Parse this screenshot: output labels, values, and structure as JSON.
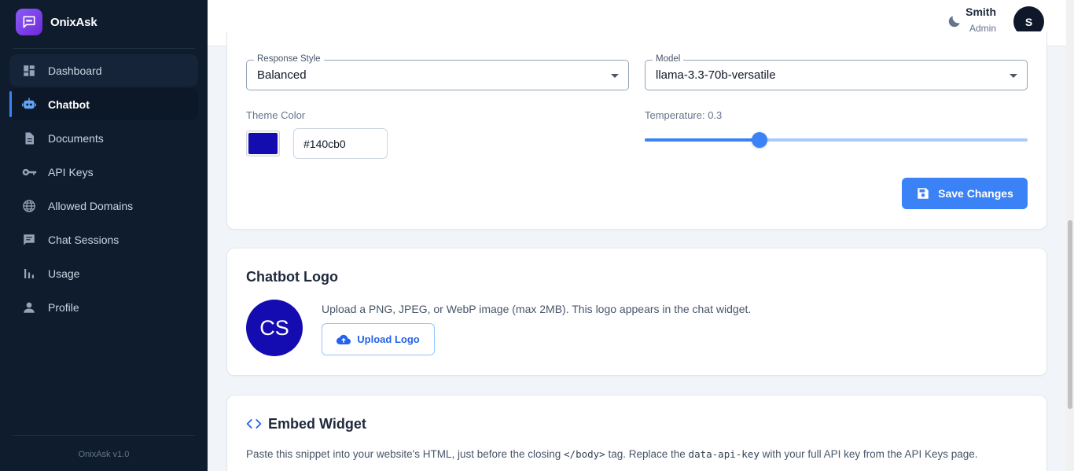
{
  "brand": {
    "name": "OnixAsk",
    "version": "OnixAsk v1.0"
  },
  "sidebar": {
    "items": [
      {
        "label": "Dashboard",
        "icon": "dashboard-icon"
      },
      {
        "label": "Chatbot",
        "icon": "robot-icon",
        "active": true
      },
      {
        "label": "Documents",
        "icon": "document-icon"
      },
      {
        "label": "API Keys",
        "icon": "key-icon"
      },
      {
        "label": "Allowed Domains",
        "icon": "globe-icon"
      },
      {
        "label": "Chat Sessions",
        "icon": "chat-icon"
      },
      {
        "label": "Usage",
        "icon": "bar-chart-icon"
      },
      {
        "label": "Profile",
        "icon": "person-icon"
      }
    ]
  },
  "header": {
    "theme_toggle_icon": "moon-icon",
    "user": {
      "name": "Smith",
      "role": "Admin",
      "initial": "S"
    }
  },
  "settings": {
    "response_style": {
      "label": "Response Style",
      "value": "Balanced"
    },
    "model": {
      "label": "Model",
      "value": "llama-3.3-70b-versatile"
    },
    "theme_color": {
      "label": "Theme Color",
      "value": "#140cb0",
      "swatch": "#140cb0"
    },
    "temperature": {
      "label": "Temperature: 0.3",
      "value": 0.3,
      "fraction": 0.3
    },
    "save_label": "Save Changes"
  },
  "logo_section": {
    "title": "Chatbot Logo",
    "initials": "CS",
    "description": "Upload a PNG, JPEG, or WebP image (max 2MB). This logo appears in the chat widget.",
    "upload_label": "Upload Logo"
  },
  "embed_section": {
    "title": "Embed Widget",
    "desc_part1": "Paste this snippet into your website's HTML, just before the closing ",
    "desc_code1": "</body>",
    "desc_part2": " tag. Replace the ",
    "desc_code2": "data-api-key",
    "desc_part3": " with your full API key from the API Keys page."
  },
  "colors": {
    "accent": "#3b82f6",
    "sidebar_bg": "#0f1c2e",
    "theme": "#140cb0"
  }
}
